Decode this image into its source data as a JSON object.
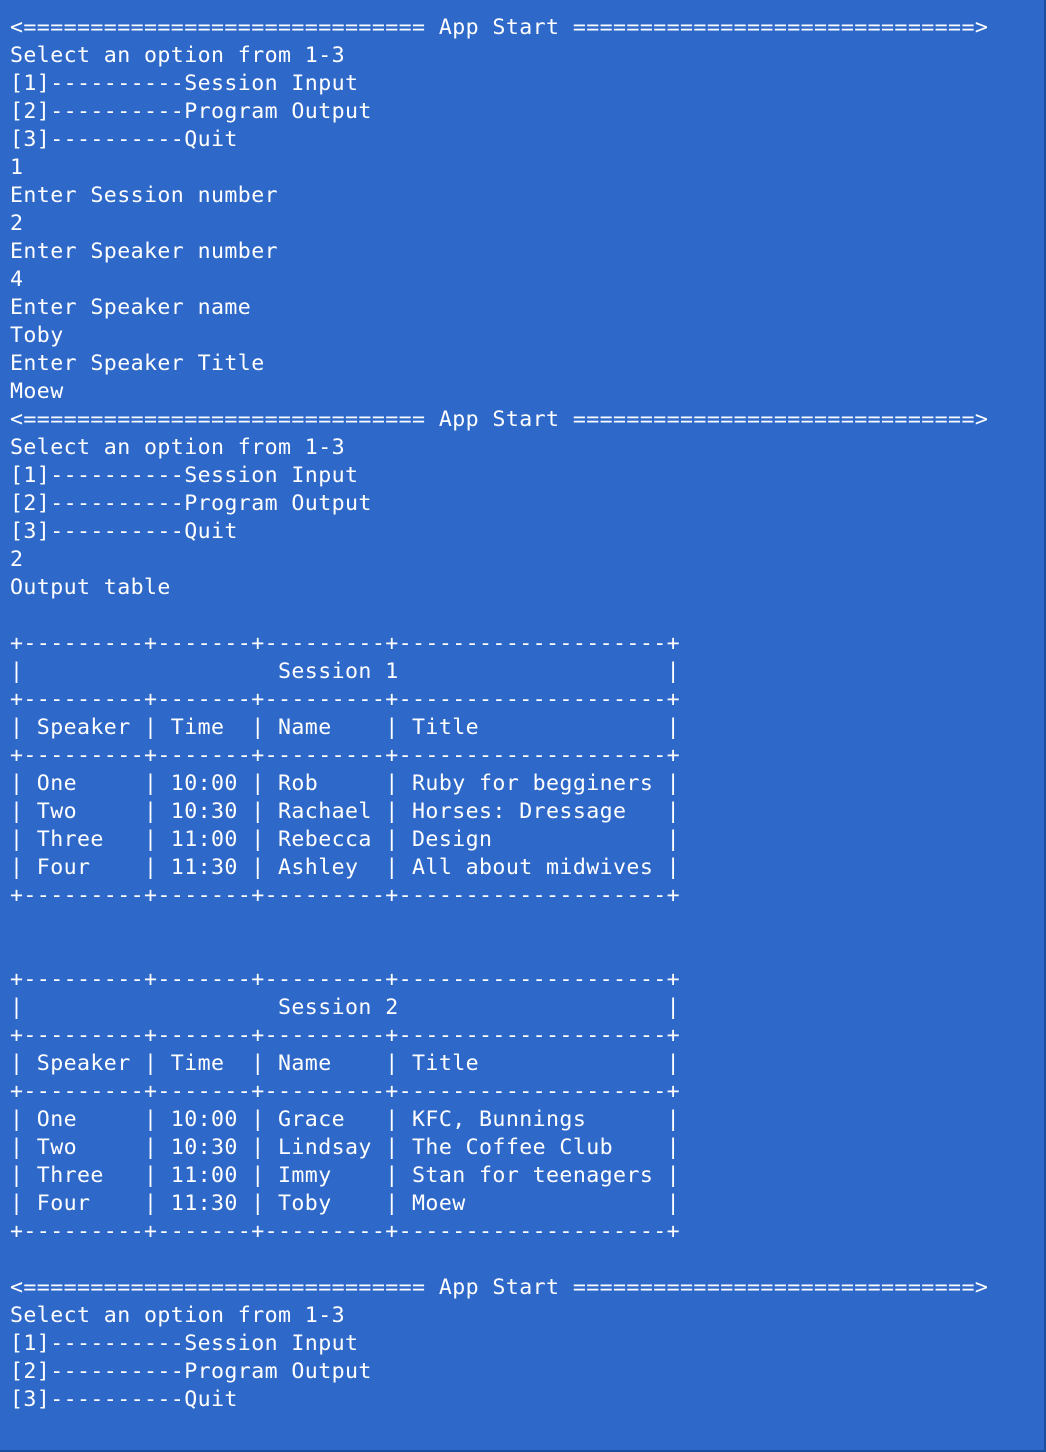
{
  "terminal": {
    "background": "#2e68c8",
    "foreground": "#ffffff",
    "lines": [
      "<============================== App Start ==============================>",
      "Select an option from 1-3",
      "[1]----------Session Input",
      "[2]----------Program Output",
      "[3]----------Quit",
      "1",
      "Enter Session number",
      "2",
      "Enter Speaker number",
      "4",
      "Enter Speaker name",
      "Toby",
      "Enter Speaker Title",
      "Moew",
      "<============================== App Start ==============================>",
      "Select an option from 1-3",
      "[1]----------Session Input",
      "[2]----------Program Output",
      "[3]----------Quit",
      "2",
      "Output table",
      "",
      "+---------+-------+---------+--------------------+",
      "|                   Session 1                    |",
      "+---------+-------+---------+--------------------+",
      "| Speaker | Time  | Name    | Title              |",
      "+---------+-------+---------+--------------------+",
      "| One     | 10:00 | Rob     | Ruby for begginers |",
      "| Two     | 10:30 | Rachael | Horses: Dressage   |",
      "| Three   | 11:00 | Rebecca | Design             |",
      "| Four    | 11:30 | Ashley  | All about midwives |",
      "+---------+-------+---------+--------------------+",
      "",
      "",
      "+---------+-------+---------+--------------------+",
      "|                   Session 2                    |",
      "+---------+-------+---------+--------------------+",
      "| Speaker | Time  | Name    | Title              |",
      "+---------+-------+---------+--------------------+",
      "| One     | 10:00 | Grace   | KFC, Bunnings      |",
      "| Two     | 10:30 | Lindsay | The Coffee Club    |",
      "| Three   | 11:00 | Immy    | Stan for teenagers |",
      "| Four    | 11:30 | Toby    | Moew               |",
      "+---------+-------+---------+--------------------+",
      "",
      "<============================== App Start ==============================>",
      "Select an option from 1-3",
      "[1]----------Session Input",
      "[2]----------Program Output",
      "[3]----------Quit"
    ]
  }
}
